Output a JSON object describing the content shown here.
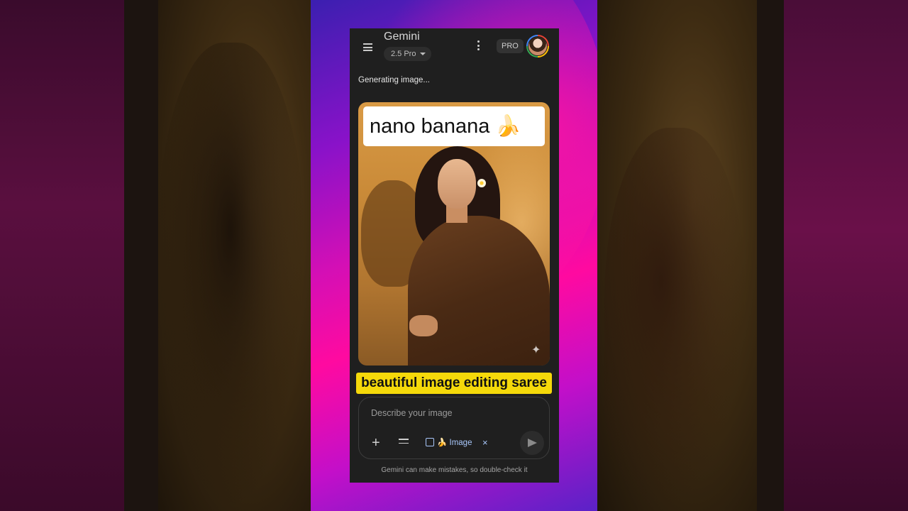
{
  "app": {
    "title": "Gemini",
    "model": "2.5 Pro",
    "plan_badge": "PRO"
  },
  "chat": {
    "status_text": "Generating image...",
    "image_overlay_text": "nano banana 🍌",
    "caption_text": "beautiful image editing saree"
  },
  "composer": {
    "placeholder": "Describe your image",
    "chip_label": "🍌 Image",
    "chip_close": "×"
  },
  "footer": {
    "disclaimer": "Gemini can make mistakes, so double-check it"
  },
  "icons": [
    "menu-icon",
    "chevron-down-icon",
    "more-vert-icon",
    "avatar",
    "sparkle-icon",
    "plus-icon",
    "tools-icon",
    "image-icon",
    "close-icon",
    "send-icon"
  ],
  "colors": {
    "phone_bg": "#1f1f1f",
    "caption_bg": "#f5d90a",
    "chip_text": "#a8c7fa",
    "side_gradient": "#ff0aa0"
  }
}
